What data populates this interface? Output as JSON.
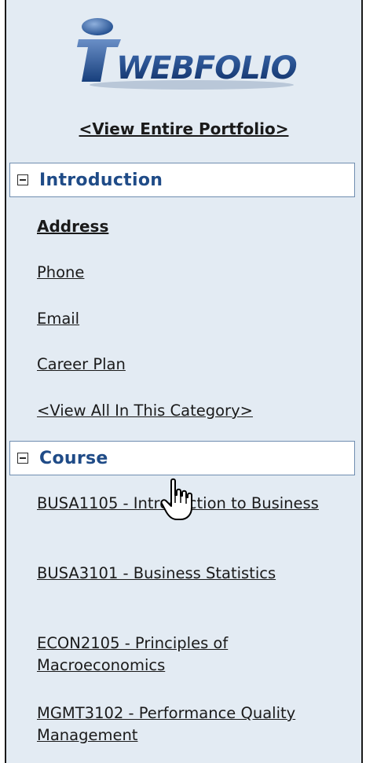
{
  "logo": {
    "text": "iWEBFOLIO",
    "icon": "iwebfolio-logo"
  },
  "nav": {
    "view_portfolio": "<View Entire Portfolio>"
  },
  "sections": [
    {
      "title": "Introduction",
      "toggle": "collapse",
      "items": [
        {
          "label": "Address",
          "selected": true
        },
        {
          "label": "Phone"
        },
        {
          "label": "Email"
        },
        {
          "label": "Career Plan"
        },
        {
          "label": "<View All In This Category>"
        }
      ]
    },
    {
      "title": "Course",
      "toggle": "collapse",
      "items": [
        {
          "label": "BUSA1105 - Introduction to Business"
        },
        {
          "label": "BUSA3101 - Business Statistics"
        },
        {
          "label": "ECON2105 - Principles of Macroeconomics"
        },
        {
          "label": "MGMT3102 - Performance Quality Management"
        }
      ]
    }
  ],
  "colors": {
    "panel_bg": "#e3ebf3",
    "section_title": "#1f4b87",
    "section_border": "#6f8db0",
    "link_text": "#1a1a1a"
  },
  "cursor": {
    "icon": "hand-pointer-cursor-icon"
  }
}
